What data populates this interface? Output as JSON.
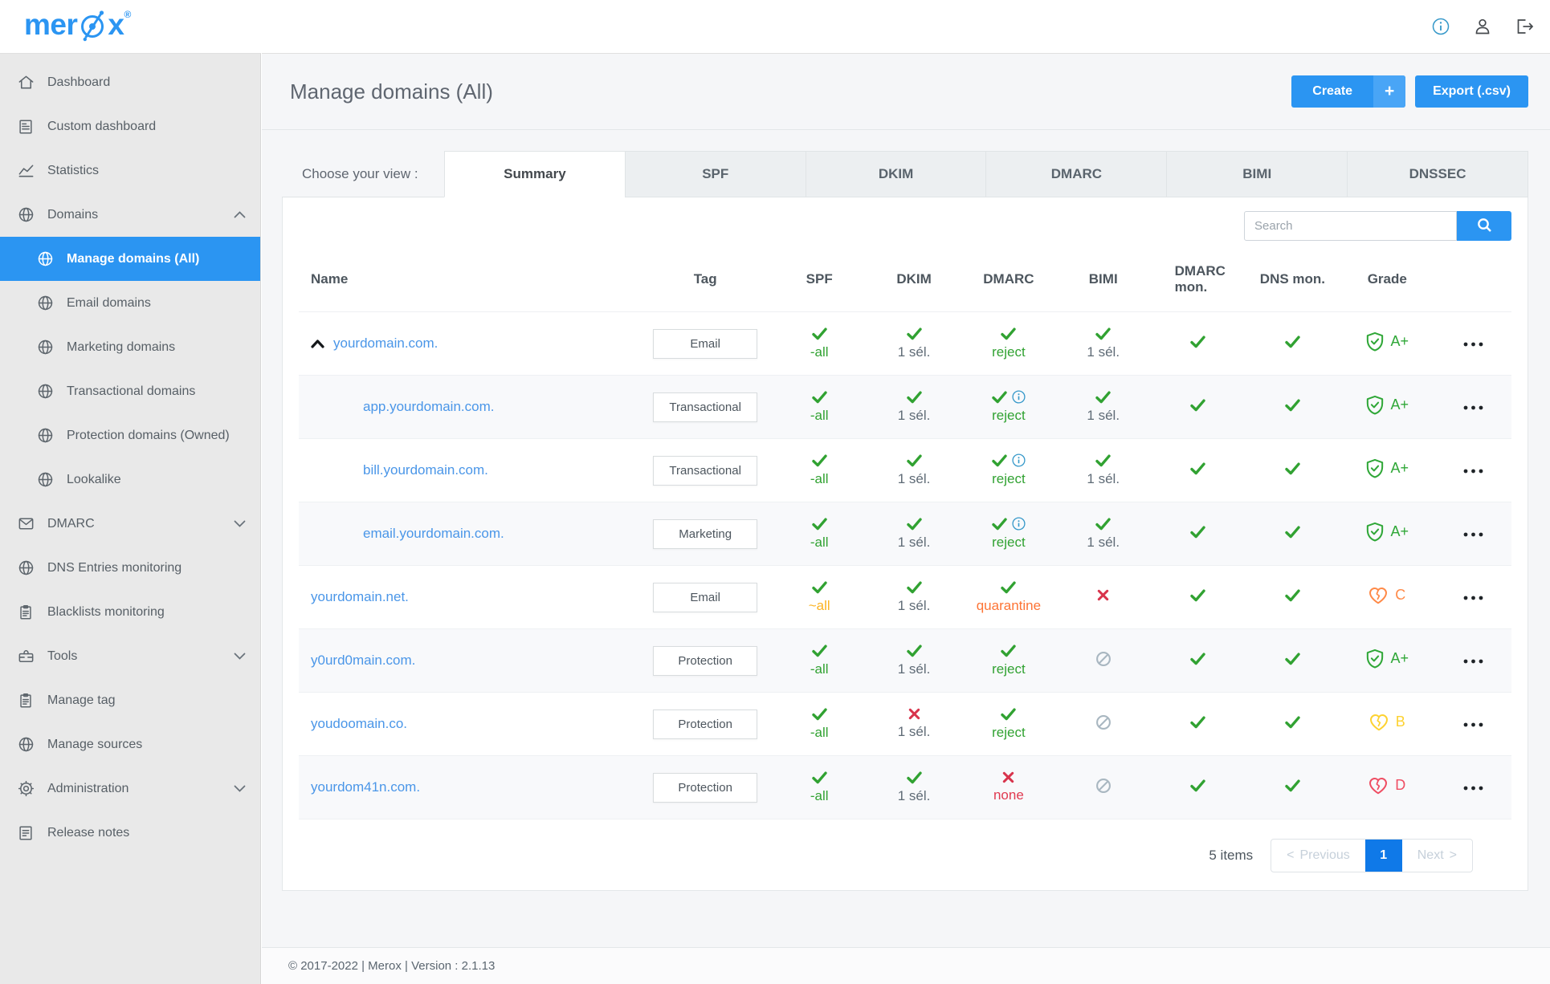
{
  "brand": {
    "logo_left": "mer",
    "logo_right": "x",
    "registered": "®"
  },
  "header": {
    "icons": [
      "info-icon",
      "user-icon",
      "logout-icon"
    ]
  },
  "sidebar": {
    "items": [
      {
        "label": "Dashboard",
        "icon": "home"
      },
      {
        "label": "Custom dashboard",
        "icon": "document"
      },
      {
        "label": "Statistics",
        "icon": "chart"
      },
      {
        "label": "Domains",
        "icon": "globe",
        "chevron": "up"
      },
      {
        "label": "Manage domains (All)",
        "icon": "globe",
        "sub": true,
        "active": true
      },
      {
        "label": "Email domains",
        "icon": "globe",
        "sub": true
      },
      {
        "label": "Marketing domains",
        "icon": "globe",
        "sub": true
      },
      {
        "label": "Transactional domains",
        "icon": "globe",
        "sub": true
      },
      {
        "label": "Protection domains (Owned)",
        "icon": "globe",
        "sub": true
      },
      {
        "label": "Lookalike",
        "icon": "globe",
        "sub": true
      },
      {
        "label": "DMARC",
        "icon": "mail",
        "chevron": "down"
      },
      {
        "label": "DNS Entries monitoring",
        "icon": "globe"
      },
      {
        "label": "Blacklists monitoring",
        "icon": "clipboard"
      },
      {
        "label": "Tools",
        "icon": "toolbox",
        "chevron": "down"
      },
      {
        "label": "Manage tag",
        "icon": "clipboard"
      },
      {
        "label": "Manage sources",
        "icon": "globe"
      },
      {
        "label": "Administration",
        "icon": "gear",
        "chevron": "down"
      },
      {
        "label": "Release notes",
        "icon": "notes"
      }
    ]
  },
  "page": {
    "title": "Manage domains (All)",
    "create_label": "Create",
    "create_plus": "+",
    "export_label": "Export (.csv)"
  },
  "tabs": {
    "label": "Choose your view :",
    "items": [
      "Summary",
      "SPF",
      "DKIM",
      "DMARC",
      "BIMI",
      "DNSSEC"
    ],
    "active": "Summary"
  },
  "search": {
    "placeholder": "Search"
  },
  "table": {
    "columns": [
      "Name",
      "Tag",
      "SPF",
      "DKIM",
      "DMARC",
      "BIMI",
      "DMARC mon.",
      "DNS mon.",
      "Grade"
    ],
    "rows": [
      {
        "name": "yourdomain.com.",
        "sub": false,
        "expander": true,
        "tag": "Email",
        "spf": {
          "mark": "check",
          "text": "-all",
          "tone": "green"
        },
        "dkim": {
          "mark": "check",
          "text": "1 sél.",
          "tone": "gray"
        },
        "dmarc": {
          "mark": "check",
          "info": false,
          "text": "reject",
          "tone": "green"
        },
        "bimi": {
          "mark": "check",
          "text": "1 sél.",
          "tone": "gray"
        },
        "dmarc_mon": {
          "mark": "check"
        },
        "dns_mon": {
          "mark": "check"
        },
        "grade": {
          "label": "A+",
          "icon": "shield",
          "tone": "green"
        }
      },
      {
        "name": "app.yourdomain.com.",
        "sub": true,
        "expander": false,
        "tag": "Transactional",
        "spf": {
          "mark": "check",
          "text": "-all",
          "tone": "green"
        },
        "dkim": {
          "mark": "check",
          "text": "1 sél.",
          "tone": "gray"
        },
        "dmarc": {
          "mark": "check",
          "info": true,
          "text": "reject",
          "tone": "green"
        },
        "bimi": {
          "mark": "check",
          "text": "1 sél.",
          "tone": "gray"
        },
        "dmarc_mon": {
          "mark": "check"
        },
        "dns_mon": {
          "mark": "check"
        },
        "grade": {
          "label": "A+",
          "icon": "shield",
          "tone": "green"
        }
      },
      {
        "name": "bill.yourdomain.com.",
        "sub": true,
        "expander": false,
        "tag": "Transactional",
        "spf": {
          "mark": "check",
          "text": "-all",
          "tone": "green"
        },
        "dkim": {
          "mark": "check",
          "text": "1 sél.",
          "tone": "gray"
        },
        "dmarc": {
          "mark": "check",
          "info": true,
          "text": "reject",
          "tone": "green"
        },
        "bimi": {
          "mark": "check",
          "text": "1 sél.",
          "tone": "gray"
        },
        "dmarc_mon": {
          "mark": "check"
        },
        "dns_mon": {
          "mark": "check"
        },
        "grade": {
          "label": "A+",
          "icon": "shield",
          "tone": "green"
        }
      },
      {
        "name": "email.yourdomain.com.",
        "sub": true,
        "expander": false,
        "tag": "Marketing",
        "spf": {
          "mark": "check",
          "text": "-all",
          "tone": "green"
        },
        "dkim": {
          "mark": "check",
          "text": "1 sél.",
          "tone": "gray"
        },
        "dmarc": {
          "mark": "check",
          "info": true,
          "text": "reject",
          "tone": "green"
        },
        "bimi": {
          "mark": "check",
          "text": "1 sél.",
          "tone": "gray"
        },
        "dmarc_mon": {
          "mark": "check"
        },
        "dns_mon": {
          "mark": "check"
        },
        "grade": {
          "label": "A+",
          "icon": "shield",
          "tone": "green"
        }
      },
      {
        "name": "yourdomain.net.",
        "sub": false,
        "expander": false,
        "tag": "Email",
        "spf": {
          "mark": "check",
          "text": "~all",
          "tone": "amber"
        },
        "dkim": {
          "mark": "check",
          "text": "1 sél.",
          "tone": "gray"
        },
        "dmarc": {
          "mark": "check",
          "info": false,
          "text": "quarantine",
          "tone": "orange"
        },
        "bimi": {
          "mark": "cross"
        },
        "dmarc_mon": {
          "mark": "check"
        },
        "dns_mon": {
          "mark": "check"
        },
        "grade": {
          "label": "C",
          "icon": "heart",
          "tone": "orange"
        }
      },
      {
        "name": "y0urd0main.com.",
        "sub": false,
        "expander": false,
        "tag": "Protection",
        "spf": {
          "mark": "check",
          "text": "-all",
          "tone": "green"
        },
        "dkim": {
          "mark": "check",
          "text": "1 sél.",
          "tone": "gray"
        },
        "dmarc": {
          "mark": "check",
          "info": false,
          "text": "reject",
          "tone": "green"
        },
        "bimi": {
          "mark": "ban"
        },
        "dmarc_mon": {
          "mark": "check"
        },
        "dns_mon": {
          "mark": "check"
        },
        "grade": {
          "label": "A+",
          "icon": "shield",
          "tone": "green"
        }
      },
      {
        "name": "youdoomain.co.",
        "sub": false,
        "expander": false,
        "tag": "Protection",
        "spf": {
          "mark": "check",
          "text": "-all",
          "tone": "green"
        },
        "dkim": {
          "mark": "cross",
          "text": "1 sél.",
          "tone": "gray"
        },
        "dmarc": {
          "mark": "check",
          "info": false,
          "text": "reject",
          "tone": "green"
        },
        "bimi": {
          "mark": "ban"
        },
        "dmarc_mon": {
          "mark": "check"
        },
        "dns_mon": {
          "mark": "check"
        },
        "grade": {
          "label": "B",
          "icon": "heart",
          "tone": "yellow"
        }
      },
      {
        "name": "yourdom41n.com.",
        "sub": false,
        "expander": false,
        "tag": "Protection",
        "spf": {
          "mark": "check",
          "text": "-all",
          "tone": "green"
        },
        "dkim": {
          "mark": "check",
          "text": "1 sél.",
          "tone": "gray"
        },
        "dmarc": {
          "mark": "cross",
          "info": false,
          "text": "none",
          "tone": "red"
        },
        "bimi": {
          "mark": "ban"
        },
        "dmarc_mon": {
          "mark": "check"
        },
        "dns_mon": {
          "mark": "check"
        },
        "grade": {
          "label": "D",
          "icon": "heart",
          "tone": "red"
        }
      }
    ]
  },
  "pagination": {
    "count": "5 items",
    "prev_chev": "<",
    "prev": "Previous",
    "page": "1",
    "next": "Next",
    "next_chev": ">"
  },
  "footer": {
    "copyright": "© 2017-2022 | Merox | Version : 2.1.13"
  }
}
